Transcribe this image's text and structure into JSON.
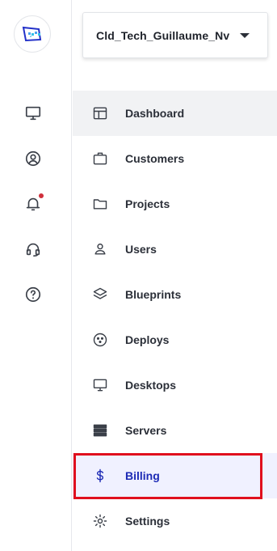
{
  "workspace": {
    "name": "Cld_Tech_Guillaume_Nv"
  },
  "rail": {
    "icons": [
      {
        "name": "monitor-icon"
      },
      {
        "name": "user-circle-icon"
      },
      {
        "name": "bell-icon",
        "notification": true
      },
      {
        "name": "headset-icon"
      },
      {
        "name": "help-icon"
      }
    ]
  },
  "menu": {
    "items": [
      {
        "label": "Dashboard",
        "icon": "dashboard-icon"
      },
      {
        "label": "Customers",
        "icon": "briefcase-icon"
      },
      {
        "label": "Projects",
        "icon": "folder-icon"
      },
      {
        "label": "Users",
        "icon": "user-icon"
      },
      {
        "label": "Blueprints",
        "icon": "layers-icon"
      },
      {
        "label": "Deploys",
        "icon": "deploy-icon"
      },
      {
        "label": "Desktops",
        "icon": "desktop-icon"
      },
      {
        "label": "Servers",
        "icon": "server-icon"
      },
      {
        "label": "Billing",
        "icon": "dollar-icon"
      },
      {
        "label": "Settings",
        "icon": "gear-icon"
      }
    ],
    "active": "Dashboard",
    "selected": "Billing"
  },
  "colors": {
    "accent": "#1d2bb5",
    "highlight": "#e0101e",
    "notification": "#d0303c"
  }
}
